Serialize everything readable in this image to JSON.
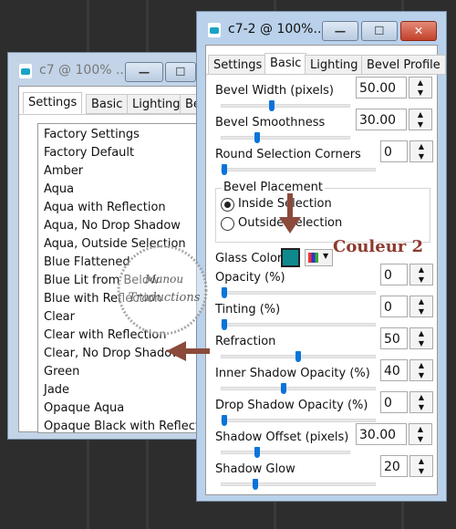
{
  "left_window": {
    "title": "c7 @ 100% ...",
    "minimize_label": "—",
    "maximize_label": "☐",
    "tabs": [
      "Settings",
      "Basic",
      "Lighting",
      "Beve"
    ],
    "active_tab": 0,
    "presets": [
      "Factory Settings",
      "Factory Default",
      "Amber",
      "Aqua",
      "Aqua with Reflection",
      "Aqua, No Drop Shadow",
      "Aqua, Outside Selection",
      "Blue Flattened",
      "Blue Lit from Below",
      "Blue with Reflection",
      "Clear",
      "Clear with Reflection",
      "Clear, No Drop Shadow",
      "Green",
      "Jade",
      "Opaque Aqua",
      "Opaque Black with Reflection"
    ]
  },
  "right_window": {
    "title": "c7-2 @ 100%...",
    "minimize_label": "—",
    "maximize_label": "☐",
    "close_label": "✕",
    "tabs": [
      "Settings",
      "Basic",
      "Lighting",
      "Bevel Profile"
    ],
    "active_tab": 1,
    "controls": [
      {
        "label": "Bevel Width (pixels)",
        "value": "50.00",
        "slider": 0.39,
        "wide": true
      },
      {
        "label": "Bevel Smoothness",
        "value": "30.00",
        "slider": 0.27,
        "wide": true
      },
      {
        "label": "Round Selection Corners",
        "value": "0",
        "slider": 0,
        "wide": false
      }
    ],
    "bevel_placement": {
      "title": "Bevel Placement",
      "options": [
        "Inside Selection",
        "Outside Selection"
      ],
      "selected": 0
    },
    "glass_color": {
      "label": "Glass Color",
      "color": "#0e8a8f"
    },
    "controls2": [
      {
        "label": "Opacity (%)",
        "value": "0",
        "slider": 0,
        "wide": false
      },
      {
        "label": "Tinting (%)",
        "value": "0",
        "slider": 0,
        "wide": false
      },
      {
        "label": "Refraction",
        "value": "50",
        "slider": 0.5,
        "wide": false
      },
      {
        "label": "Inner Shadow Opacity (%)",
        "value": "40",
        "slider": 0.4,
        "wide": false
      },
      {
        "label": "Drop Shadow Opacity (%)",
        "value": "0",
        "slider": 0,
        "wide": false
      },
      {
        "label": "Shadow Offset (pixels)",
        "value": "30.00",
        "slider": 0.27,
        "wide": true
      },
      {
        "label": "Shadow Glow",
        "value": "20",
        "slider": 0.21,
        "wide": false
      }
    ]
  },
  "annotation": {
    "text": "Couleur 2",
    "color": "#8b3a2e"
  },
  "watermark": {
    "line1": "Manou",
    "line2": "Traductions"
  }
}
